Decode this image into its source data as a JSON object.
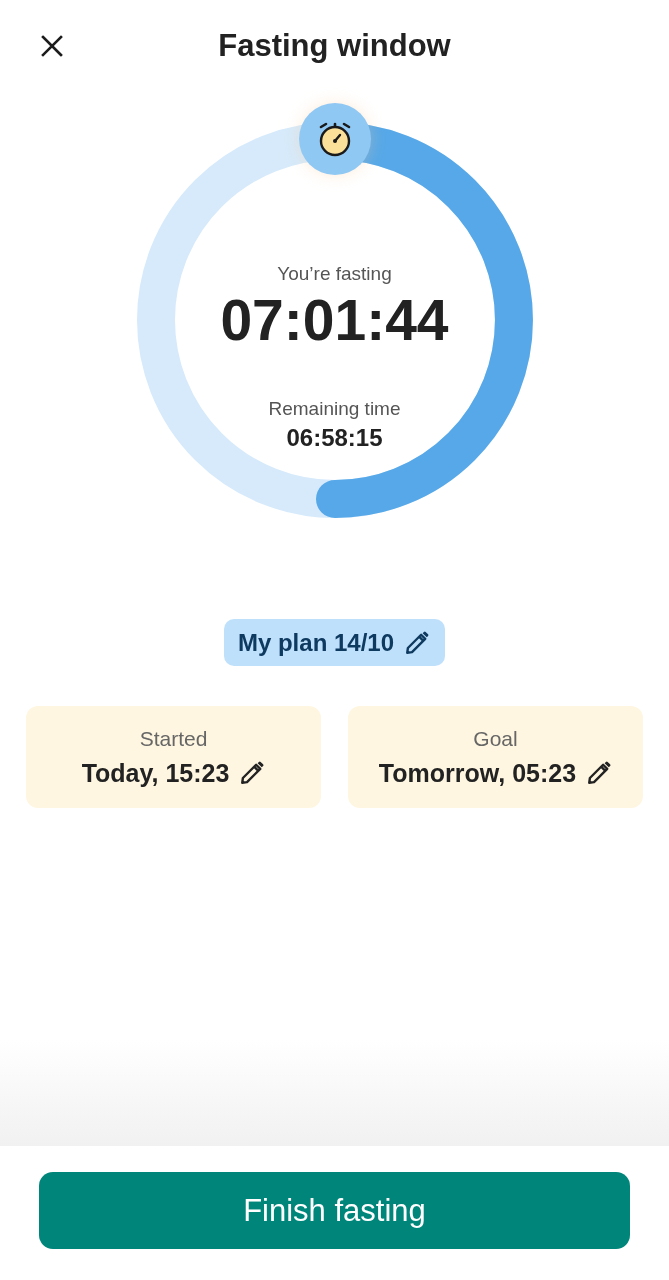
{
  "header": {
    "title": "Fasting window"
  },
  "timer": {
    "status": "You’re fasting",
    "elapsed": "07:01:44",
    "remaining_label": "Remaining time",
    "remaining": "06:58:15",
    "level": 0.5
  },
  "plan": {
    "label": "My plan 14/10"
  },
  "times": [
    {
      "label": "Started",
      "value": "Today, 15:23"
    },
    {
      "label": "Goal",
      "value": "Tomorrow, 05:23"
    }
  ],
  "primary_button": {
    "label": "Finish fasting"
  }
}
